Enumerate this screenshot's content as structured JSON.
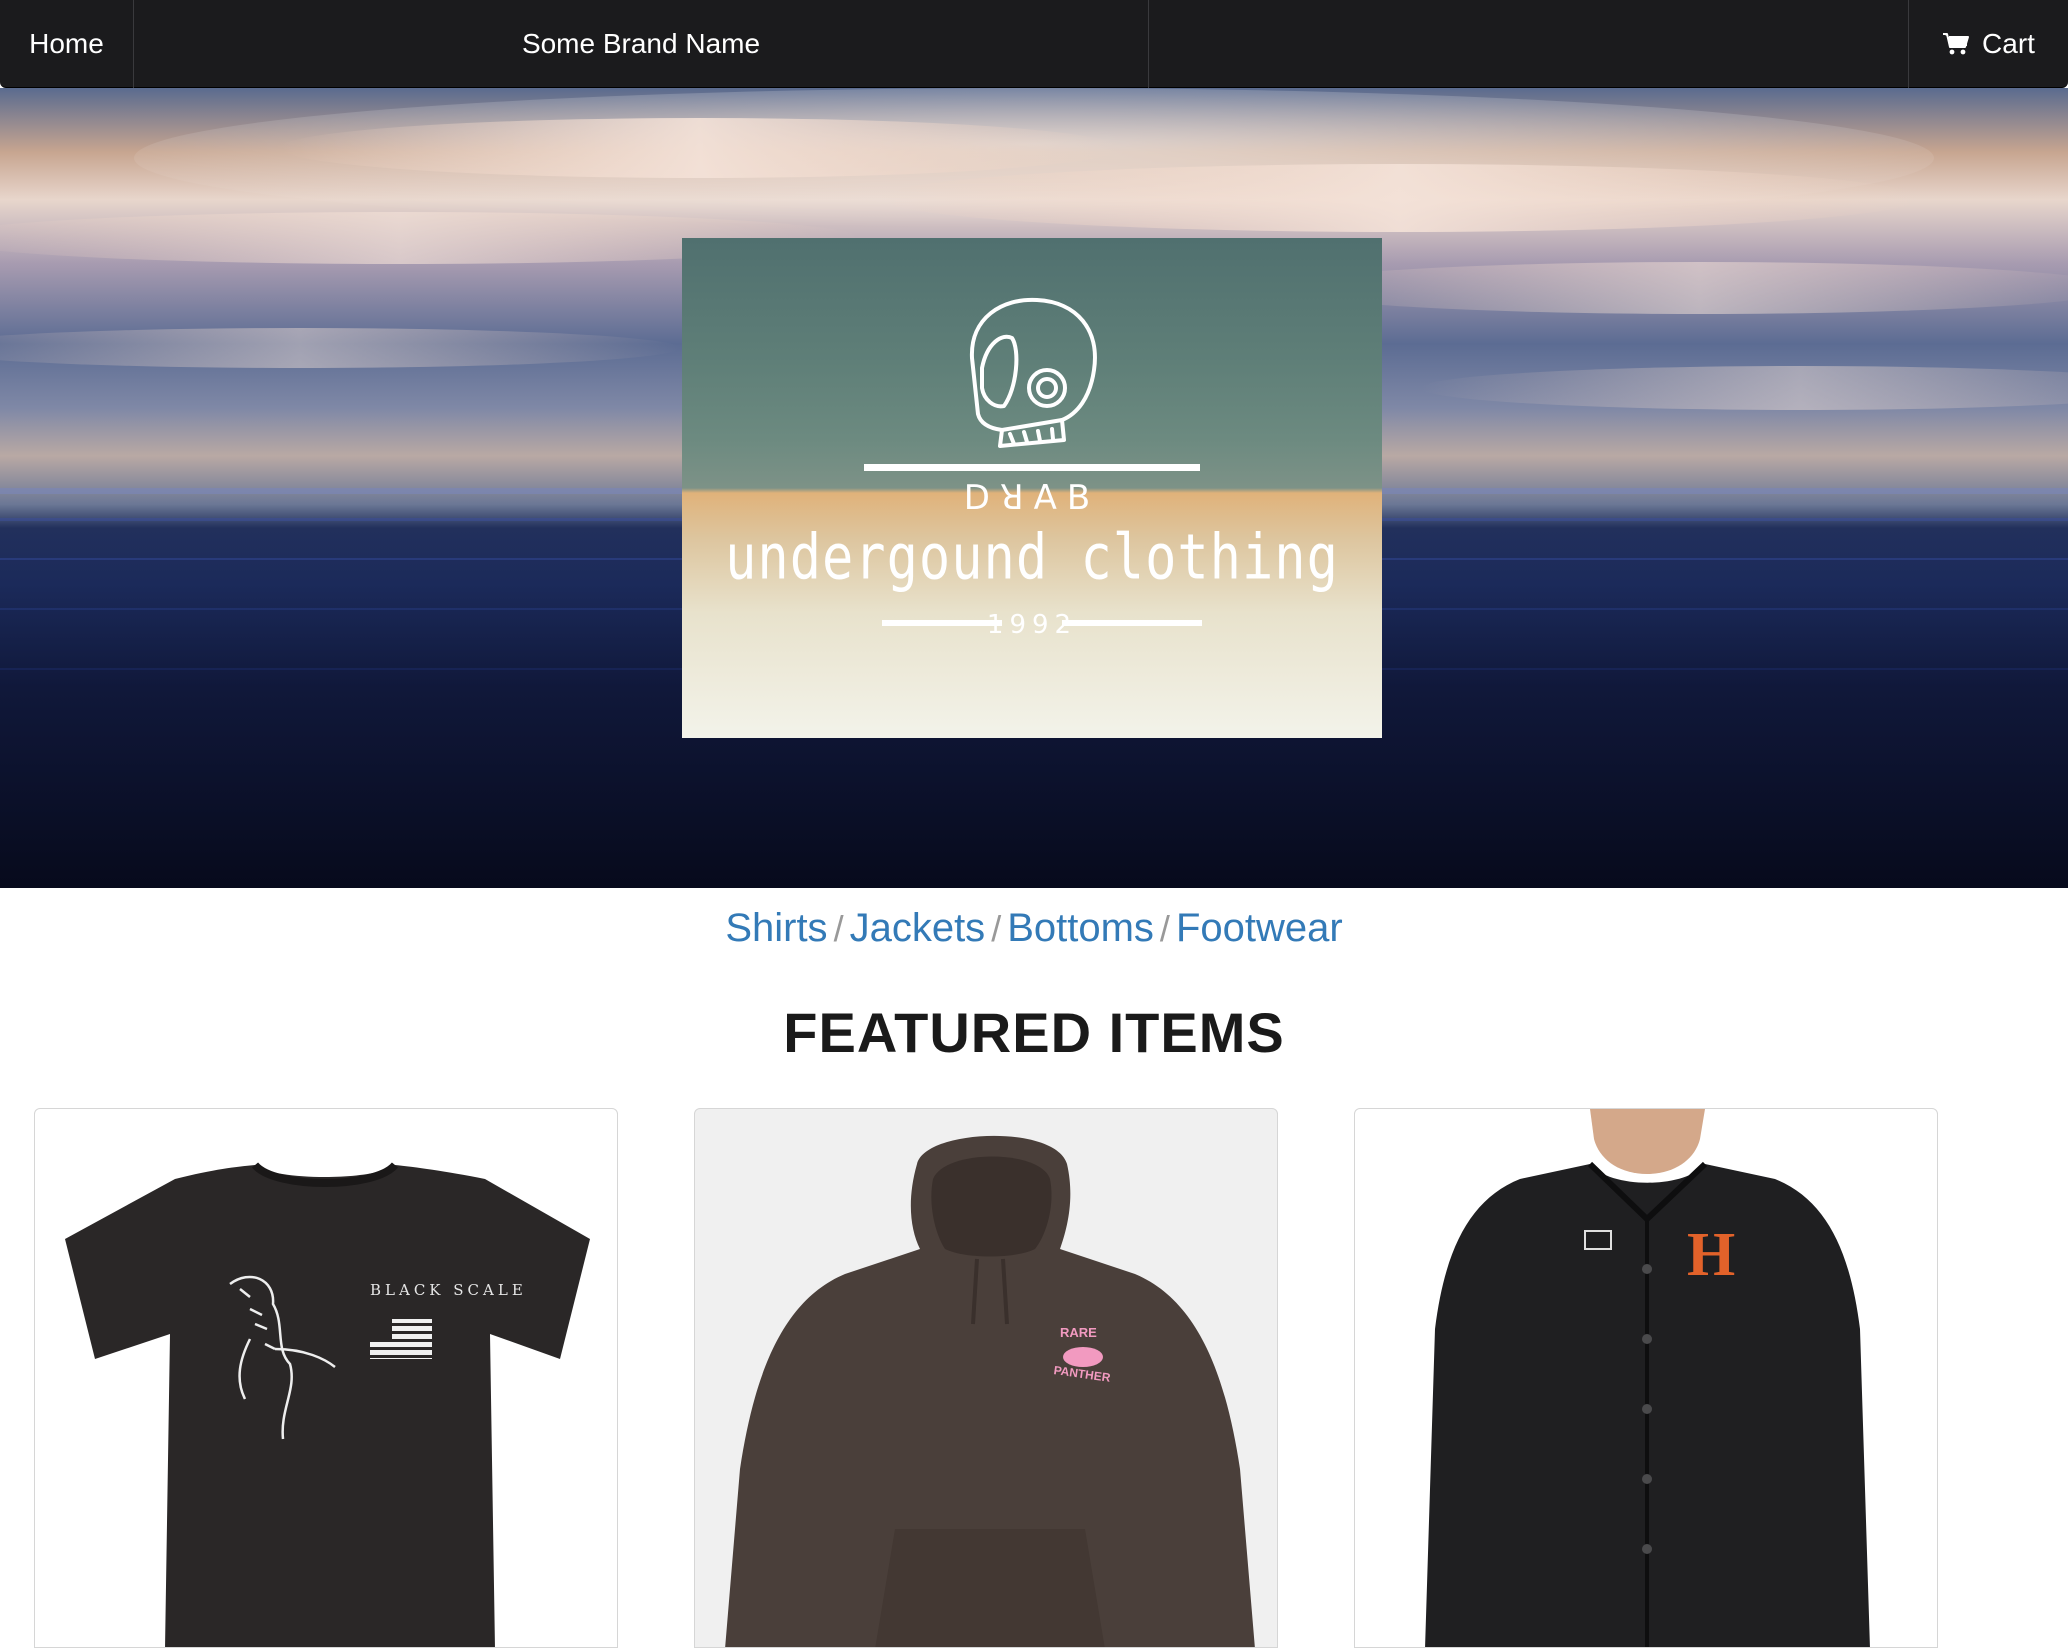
{
  "navbar": {
    "home_label": "Home",
    "brand_label": "Some Brand Name",
    "cart_label": "Cart",
    "cart_icon": "shopping-cart-icon"
  },
  "hero": {
    "logo": {
      "brand": "DRAB",
      "brand_display": "DꓤAB",
      "subtitle": "undergound clothing",
      "year": "1992",
      "emblem_icon": "astronaut-helmet-icon"
    }
  },
  "categories": [
    {
      "label": "Shirts"
    },
    {
      "label": "Jackets"
    },
    {
      "label": "Bottoms"
    },
    {
      "label": "Footwear"
    }
  ],
  "category_separator": "/",
  "featured": {
    "title": "FEATURED ITEMS",
    "items": [
      {
        "image": "black-tshirt-tiger-print",
        "graphic_text": "BLACK SCALE"
      },
      {
        "image": "brown-hoodie-pink-panther",
        "graphic_text_1": "RARE",
        "graphic_text_2": "PANTHER"
      },
      {
        "image": "black-coach-jacket-orange-h",
        "graphic_text": "H"
      }
    ]
  },
  "colors": {
    "navbar_bg": "#1b1b1d",
    "link": "#337ab7",
    "heading": "#1a1a1a",
    "accent_orange": "#e2622a",
    "accent_pink": "#f29ac0"
  }
}
